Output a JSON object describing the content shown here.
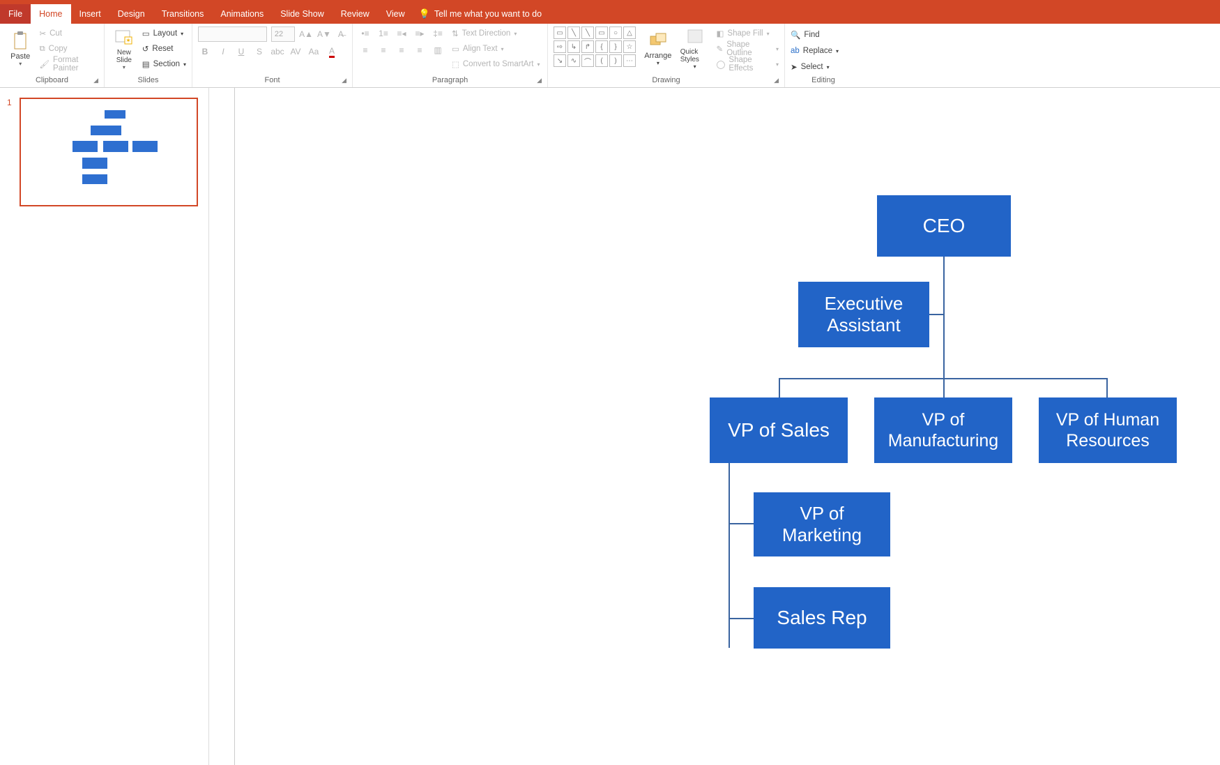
{
  "tabs": {
    "file": "File",
    "home": "Home",
    "insert": "Insert",
    "design": "Design",
    "transitions": "Transitions",
    "animations": "Animations",
    "slideshow": "Slide Show",
    "review": "Review",
    "view": "View",
    "tell_me": "Tell me what you want to do"
  },
  "ribbon": {
    "clipboard": {
      "label": "Clipboard",
      "paste": "Paste",
      "cut": "Cut",
      "copy": "Copy",
      "format_painter": "Format Painter"
    },
    "slides": {
      "label": "Slides",
      "new_slide": "New Slide",
      "layout": "Layout",
      "reset": "Reset",
      "section": "Section"
    },
    "font": {
      "label": "Font",
      "size": "22"
    },
    "paragraph": {
      "label": "Paragraph",
      "text_direction": "Text Direction",
      "align_text": "Align Text",
      "convert_smartart": "Convert to SmartArt"
    },
    "drawing": {
      "label": "Drawing",
      "arrange": "Arrange",
      "quick_styles": "Quick Styles",
      "shape_fill": "Shape Fill",
      "shape_outline": "Shape Outline",
      "shape_effects": "Shape Effects"
    },
    "editing": {
      "label": "Editing",
      "find": "Find",
      "replace": "Replace",
      "select": "Select"
    }
  },
  "thumbs": {
    "slide1_num": "1"
  },
  "chart_data": {
    "type": "org-chart",
    "nodes": {
      "ceo": "CEO",
      "ea": "Executive Assistant",
      "vp_sales": "VP of Sales",
      "vp_mfg": "VP of Manufacturing",
      "vp_hr": "VP of Human Resources",
      "vp_mkt": "VP of Marketing",
      "sales_rep": "Sales Rep"
    },
    "edges": [
      [
        "ceo",
        "ea"
      ],
      [
        "ceo",
        "vp_sales"
      ],
      [
        "ceo",
        "vp_mfg"
      ],
      [
        "ceo",
        "vp_hr"
      ],
      [
        "vp_sales",
        "vp_mkt"
      ],
      [
        "vp_sales",
        "sales_rep"
      ]
    ]
  }
}
